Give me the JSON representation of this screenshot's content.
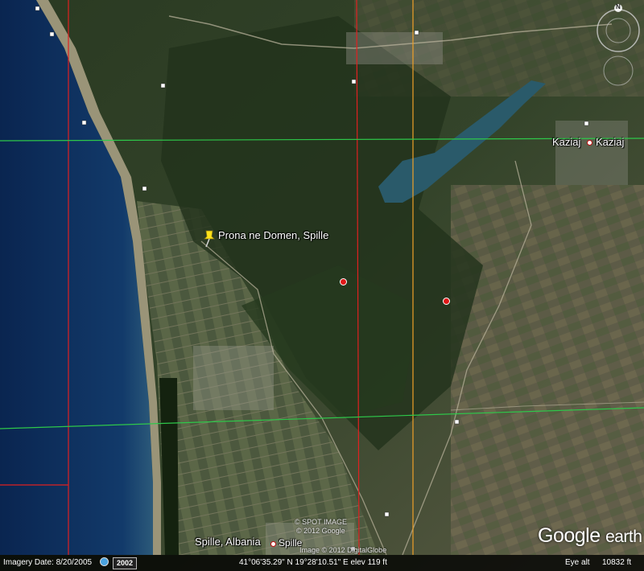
{
  "map": {
    "placemark_label": "Prona ne Domen, Spille",
    "towns": {
      "kaziaj_left": "Kaziaj",
      "kaziaj_right": "Kaziaj",
      "spille_region": "Spille, Albania",
      "spille_town": "Spille"
    },
    "credits": {
      "spot_image": "© SPOT IMAGE",
      "google": "© 2012 Google",
      "digitalglobe": "Image © 2012 DigitalGlobe"
    },
    "compass_letter": "N",
    "logo": {
      "google": "Google",
      "earth": "earth"
    },
    "colors": {
      "gridline_red": "#e02020",
      "gridline_green": "#2ec84a",
      "gridline_orange": "#f0a028",
      "water": "#0c2d5c",
      "placemark": "#ffe21a"
    }
  },
  "statusbar": {
    "imagery_date": "Imagery Date: 8/20/2005",
    "year": "2002",
    "coords": "41°06'35.29\" N  19°28'10.51\" E  elev  119 ft",
    "eye_alt_label": "Eye alt",
    "eye_alt_value": "10832 ft"
  }
}
